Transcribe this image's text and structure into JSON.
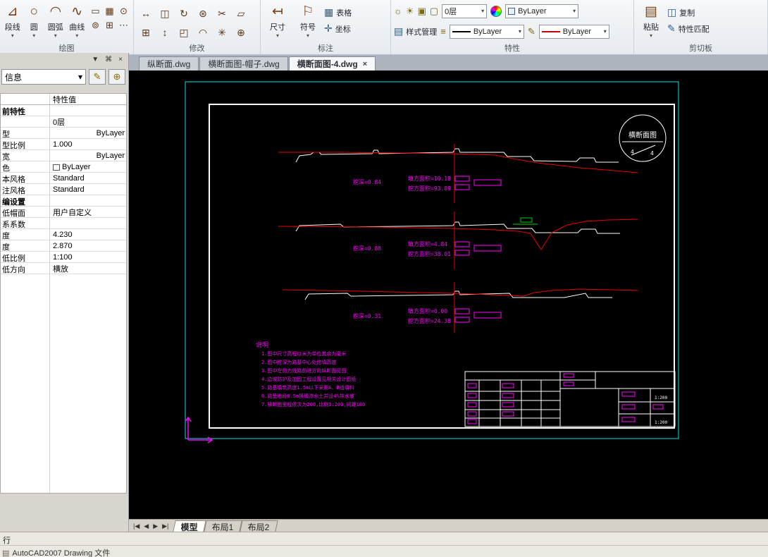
{
  "icons": {
    "down": "▾",
    "close": "×",
    "pin": "⌘",
    "dock": "▼",
    "slash": "/",
    "polyline": "⊿",
    "circle": "○",
    "arc": "◠",
    "spline": "∿",
    "rect": "▭",
    "hatch": "▦",
    "ellipse": "⊙",
    "donut": "⊚",
    "array_d": "⊞",
    "points": "⋯",
    "move": "↔",
    "stretch": "↕",
    "rotate": "↻",
    "mirror": "◫",
    "offset": "⊛",
    "trim": "✂",
    "erase": "▱",
    "array": "⊞",
    "scale": "◰",
    "fillet": "◠",
    "explode": "✳",
    "join": "⊕",
    "dim": "↤",
    "symbol": "⚐",
    "table": "▦",
    "coord": "✛",
    "style": "▤",
    "lines": "≡",
    "bulb": "☼",
    "sun": "☀",
    "lock": "▣",
    "freeze": "❄",
    "box": "▢",
    "brush": "✎",
    "paste": "▤",
    "copy": "◫",
    "match": "✎",
    "quick": "✎",
    "select": "⊕",
    "nav_first": "|◀",
    "nav_prev": "◀",
    "nav_next": "▶",
    "nav_last": "▶|",
    "file": "▤"
  },
  "ribbon": {
    "draw": {
      "label": "绘图",
      "buttons": [
        {
          "label": "段线"
        },
        {
          "label": "圆"
        },
        {
          "label": "圆弧"
        },
        {
          "label": "曲线"
        }
      ]
    },
    "modify": {
      "label": "修改"
    },
    "annotate": {
      "label": "标注",
      "dim": "尺寸",
      "symbol": "符号",
      "table": "表格",
      "coord": "坐标"
    },
    "props": {
      "label": "特性",
      "style": "样式管理",
      "layer": "0层",
      "color": "ByLayer",
      "linetype": "ByLayer",
      "lineweight": "ByLayer"
    },
    "clipboard": {
      "label": "剪切板",
      "paste": "粘贴",
      "copy": "复制",
      "match": "特性匹配"
    }
  },
  "doc_tabs": [
    {
      "label": "纵断面.dwg"
    },
    {
      "label": "横断面图-帽子.dwg"
    },
    {
      "label": "横断面图-4.dwg"
    }
  ],
  "palette": {
    "combo_value": "信息",
    "value_header": "特性值",
    "sections": [
      {
        "title": "前特性",
        "rows": [
          [
            "",
            "0层"
          ],
          [
            "型",
            "ByLayer"
          ],
          [
            "型比例",
            "1.000"
          ],
          [
            "宽",
            "ByLayer"
          ],
          [
            "色",
            "ByLayer"
          ],
          [
            "本风格",
            "Standard"
          ],
          [
            "注风格",
            "Standard"
          ]
        ]
      },
      {
        "title": "编设置",
        "rows": [
          [
            "低帽面",
            "用户自定义"
          ],
          [
            "系系数",
            ""
          ],
          [
            "度",
            "4.230"
          ],
          [
            "度",
            "2.870"
          ],
          [
            "低比例",
            "1:100"
          ],
          [
            "低方向",
            "横放"
          ]
        ]
      }
    ]
  },
  "drawing": {
    "stamp": {
      "title": "横断面图",
      "left": "4",
      "right": "4"
    },
    "sections": [
      {
        "cut_depth": "挖深=0.84",
        "fill_area": "填方面积=10.18",
        "cut_area": "挖方面积=93.89"
      },
      {
        "cut_depth": "挖深=0.88",
        "fill_area": "填方面积=4.84",
        "cut_area": "挖方面积=38.01"
      },
      {
        "cut_depth": "挖深=0.31",
        "fill_area": "填方面积=0.00",
        "cut_area": "挖方面积=24.38"
      }
    ],
    "notes_title": "说明",
    "notes": [
      "1.图中尺寸高程以米为单位其余为毫米",
      "2.图中挖深为路基中心处挖填高度",
      "3.图中左侧为线路前进方向纵断面见图",
      "4.边坡防护及加固工程设置见相关设计图纸",
      "5.路基填筑高度1.5m以下采用A、B组填料",
      "6.路堑地段0.5m换填渗水土并设4%排水坡",
      "7.横断面里程依次为200,比例1:200,间距100"
    ],
    "titleblock": {
      "scale1": "1:200",
      "scale2": "1:200"
    },
    "colors": {
      "frame": "#00e5e5",
      "geometry": "#ffffff",
      "design": "#e80000",
      "annotation": "#ff00ff",
      "aux": "#00d000"
    }
  },
  "layout_tabs": [
    {
      "label": "模型"
    },
    {
      "label": "布局1"
    },
    {
      "label": "布局2"
    }
  ],
  "status": {
    "line1": "行",
    "line2": "AutoCAD2007 Drawing 文件"
  }
}
